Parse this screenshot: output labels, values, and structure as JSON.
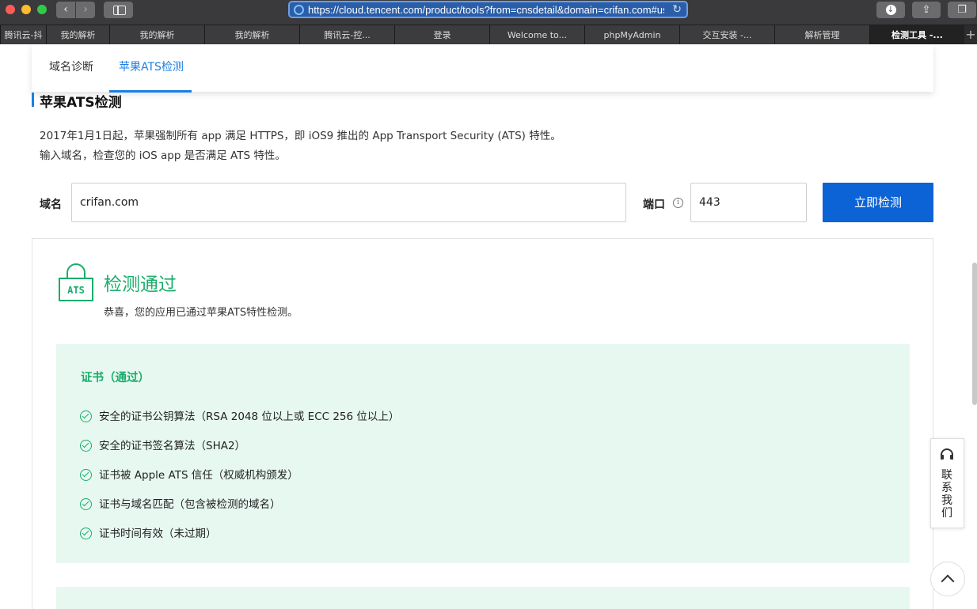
{
  "browser": {
    "url": "https://cloud.tencent.com/product/tools?from=cnsdetail&domain=crifan.com#us",
    "tabs": [
      {
        "label": "腾讯云-抖"
      },
      {
        "label": "我的解析"
      },
      {
        "label": "我的解析"
      },
      {
        "label": "我的解析"
      },
      {
        "label": "腾讯云-控..."
      },
      {
        "label": "登录"
      },
      {
        "label": "Welcome to..."
      },
      {
        "label": "phpMyAdmin"
      },
      {
        "label": "交互安装 -..."
      },
      {
        "label": "解析管理"
      },
      {
        "label": "检测工具 -...",
        "active": true
      }
    ],
    "new_tab": "+"
  },
  "subnav": {
    "tab1": "域名诊断",
    "tab2": "苹果ATS检测"
  },
  "section": {
    "title": "苹果ATS检测",
    "desc1": "2017年1月1日起，苹果强制所有 app 满足 HTTPS，即 iOS9 推出的 App Transport Security (ATS) 特性。",
    "desc2": "输入域名，检查您的 iOS app 是否满足 ATS 特性。"
  },
  "form": {
    "domain_label": "域名",
    "domain_value": "crifan.com",
    "port_label": "端口",
    "port_value": "443",
    "submit_label": "立即检测"
  },
  "result": {
    "icon_text": "ATS",
    "title": "检测通过",
    "subtitle": "恭喜，您的应用已通过苹果ATS特性检测。",
    "cert_title": "证书（通过）",
    "cert_items": [
      "安全的证书公钥算法（RSA 2048 位以上或 ECC 256 位以上）",
      "安全的证书签名算法（SHA2）",
      "证书被 Apple ATS 信任（权威机构颁发）",
      "证书与域名匹配（包含被检测的域名）",
      "证书时间有效（未过期）"
    ]
  },
  "float": {
    "contact": "联系我们"
  },
  "colors": {
    "accent_blue": "#0c63d6",
    "success_green": "#1aad6a",
    "success_bg": "#e7f8f1"
  }
}
